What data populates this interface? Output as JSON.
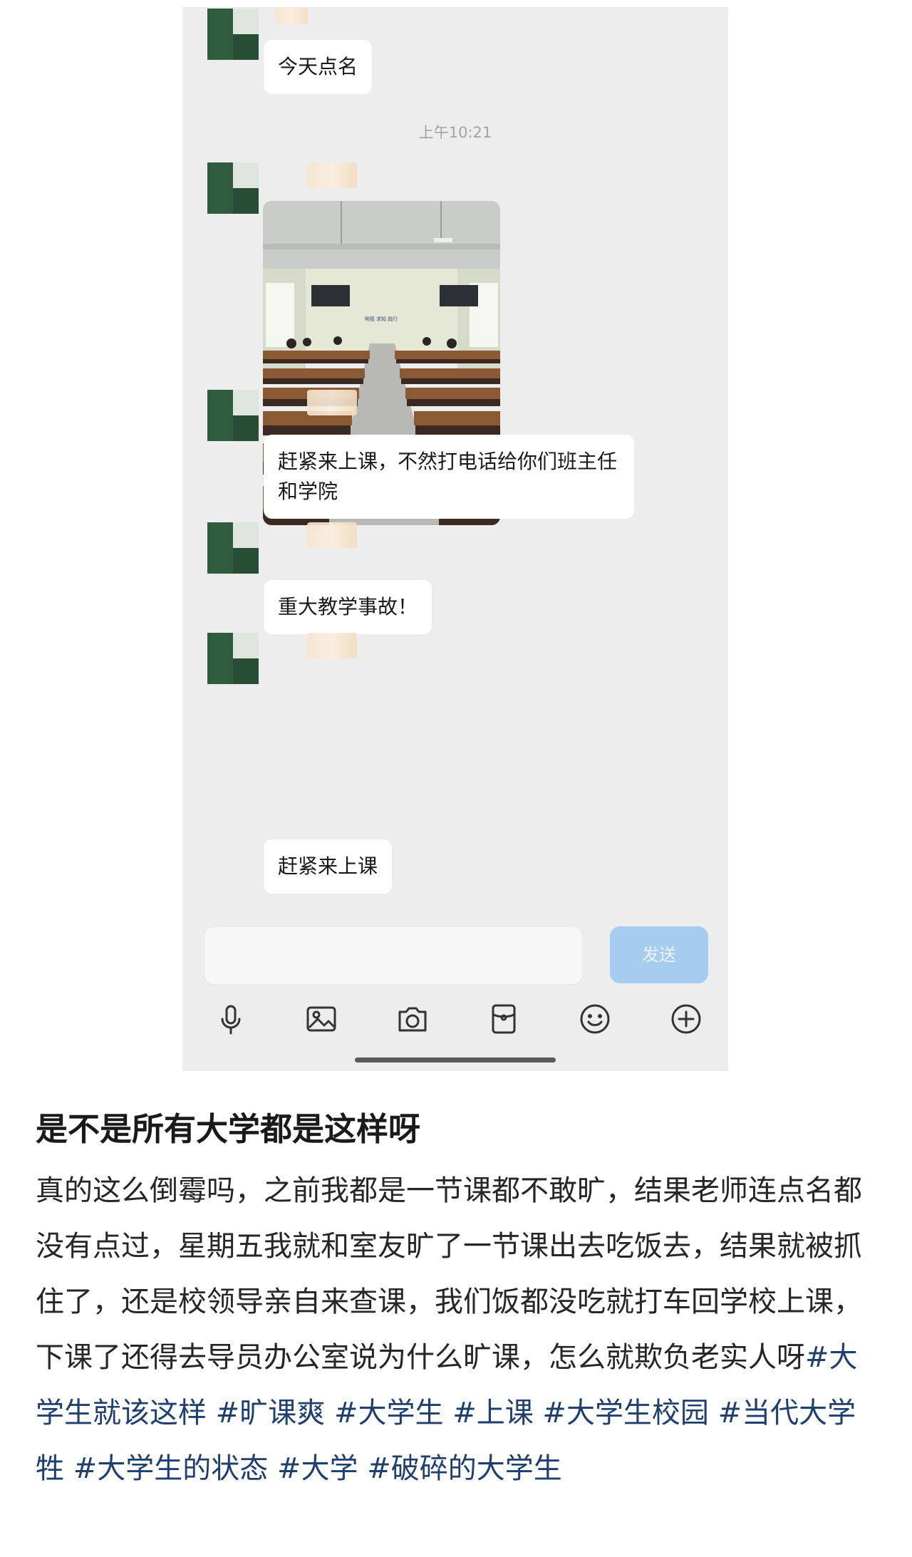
{
  "chat": {
    "messages": [
      {
        "text": "今天点名"
      },
      {
        "timestamp": "上午10:21"
      },
      {
        "image": "classroom-photo"
      },
      {
        "text": "赶紧来上课，不然打电话给你们班主任和学院"
      },
      {
        "text": "重大教学事故！"
      },
      {
        "text": "赶紧来上课"
      }
    ],
    "input": {
      "send_label": "发送"
    },
    "toolbar": {
      "icons": [
        "microphone-icon",
        "image-icon",
        "camera-icon",
        "red-packet-icon",
        "emoji-icon",
        "plus-icon"
      ]
    },
    "photo_sign": "明德 求知 践行"
  },
  "post": {
    "title": "是不是所有大学都是这样呀",
    "body": "真的这么倒霉吗，之前我都是一节课都不敢旷，结果老师连点名都没有点过，星期五我就和室友旷了一节课出去吃饭去，结果就被抓住了，还是校领导亲自来查课，我们饭都没吃就打车回学校上课，下课了还得去导员办公室说为什么旷课，怎么就欺负老实人呀",
    "tags": [
      "#大学生就该这样",
      "#旷课爽",
      "#大学生",
      "#上课",
      "#大学生校园",
      "#当代大学牲",
      "#大学生的状态",
      "#大学",
      "#破碎的大学生"
    ]
  },
  "colors": {
    "tag": "#1f3f6e",
    "send_button": "#a6cdef",
    "chat_bg": "#ededed"
  }
}
